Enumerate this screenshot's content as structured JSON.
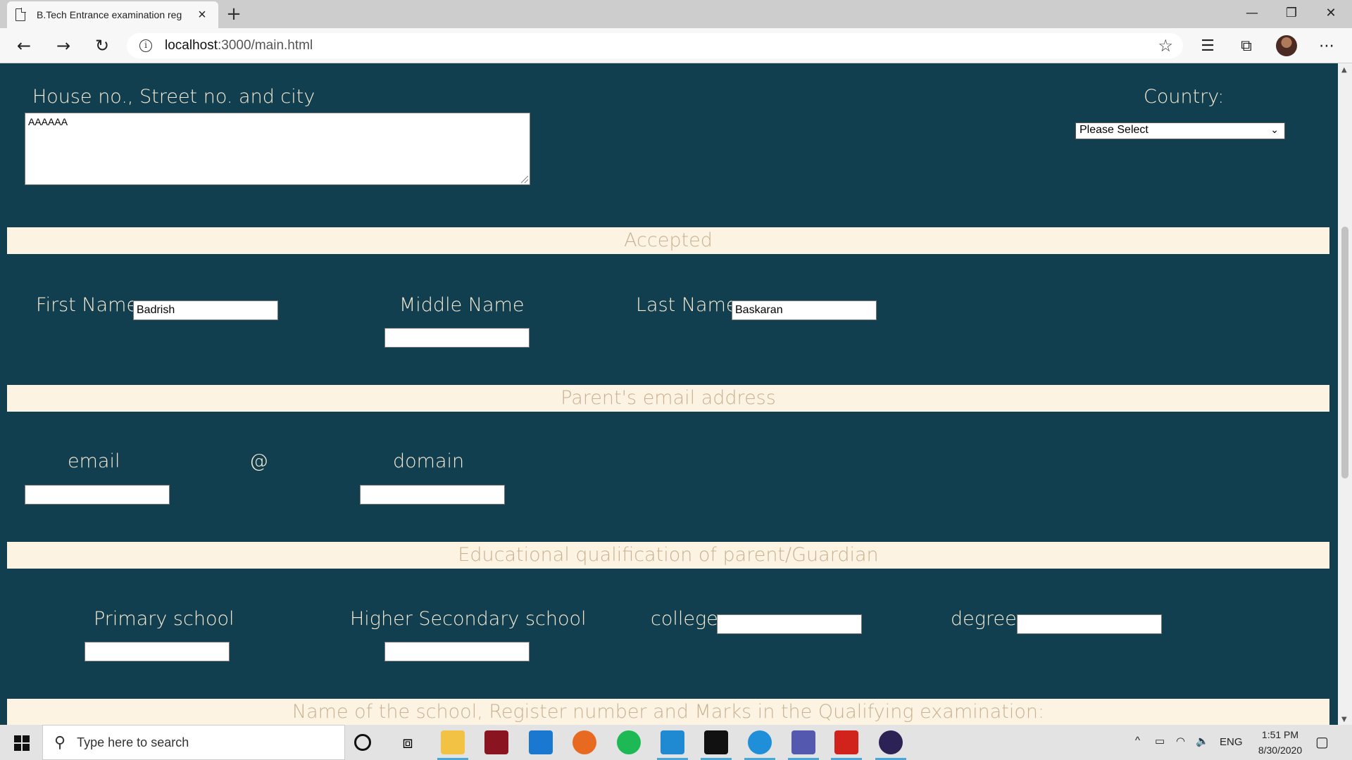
{
  "browser": {
    "tab_title": "B.Tech Entrance examination reg",
    "url_host": "localhost",
    "url_path": ":3000/main.html"
  },
  "address": {
    "label": "House no., Street no. and city",
    "value": "AAAAAA",
    "country_label": "Country:",
    "country_selected": "Please Select"
  },
  "bands": {
    "accepted": "Accepted",
    "parent_email": "Parent's email address",
    "education": "Educational qualification of parent/Guardian",
    "school": "Name of the school, Register number and Marks in the Qualifying examination:"
  },
  "name": {
    "first_label": "First Name",
    "first_value": "Badrish",
    "middle_label": "Middle Name",
    "middle_value": "",
    "last_label": "Last Name",
    "last_value": "Baskaran"
  },
  "email": {
    "email_label": "email",
    "at_label": "@",
    "domain_label": "domain"
  },
  "education": {
    "primary_label": "Primary school",
    "higher_label": "Higher Secondary school",
    "college_label": "college",
    "degree_label": "degree"
  },
  "taskbar": {
    "search_placeholder": "Type here to search",
    "language": "ENG",
    "time": "1:51 PM",
    "date": "8/30/2020"
  }
}
